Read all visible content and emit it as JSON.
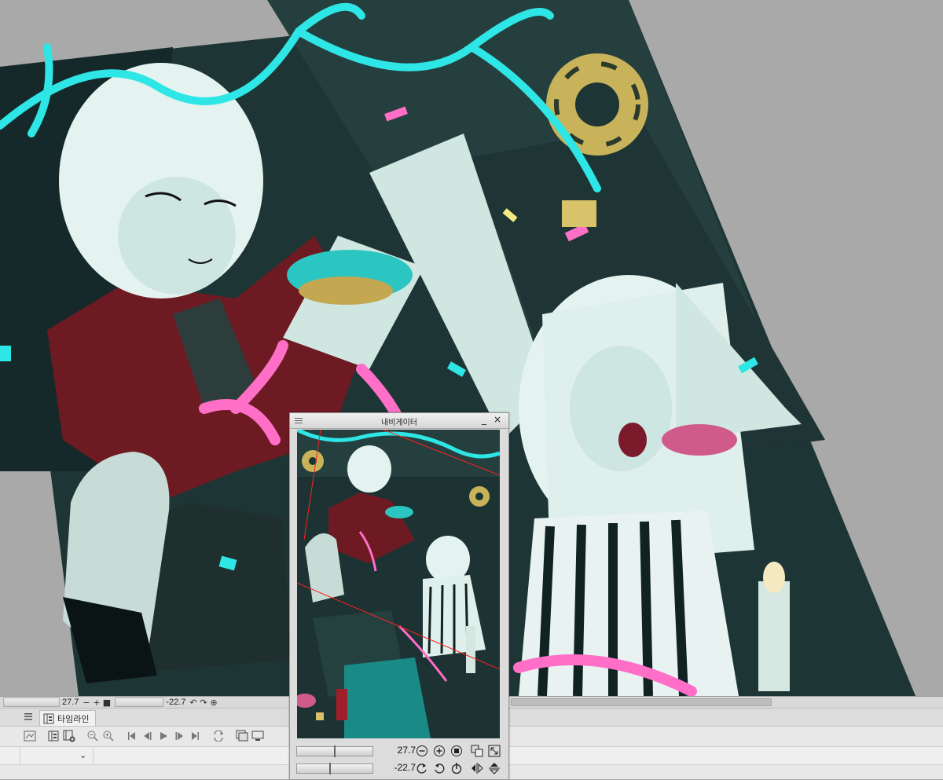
{
  "status_bar": {
    "zoom_value": "27.7",
    "zoom_out": "−",
    "zoom_in": "+",
    "stop": "■",
    "rotate_value": "-22.7",
    "rotate_left": "↶",
    "rotate_right": "↷",
    "reset_rotation": "⊕"
  },
  "timeline": {
    "tab_label": "타임라인",
    "menu_icon": "hamburger-icon",
    "toolbar_icons": [
      "new-timeline-icon",
      "frame-icon",
      "add-frame-icon",
      "zoom-out-icon",
      "zoom-in-icon",
      "first-frame-icon",
      "prev-frame-icon",
      "play-icon",
      "next-frame-icon",
      "last-frame-icon",
      "loop-icon",
      "onion-skin-icon",
      "light-table-icon"
    ],
    "dropdown_glyph": "⌄",
    "slash_a": "/",
    "slash_b": "/"
  },
  "navigator": {
    "title": "내비게이터",
    "minimize": "_",
    "close": "×",
    "zoom_value": "27.7",
    "rotate_value": "-22.7",
    "zoom_slider_percent": 50,
    "rotate_slider_percent": 44
  },
  "colors": {
    "canvas_bg": "#a9a9a9",
    "accent_cyan": "#2ee6e6",
    "accent_pink": "#ff6ec7",
    "coat_red": "#6e1a22"
  }
}
